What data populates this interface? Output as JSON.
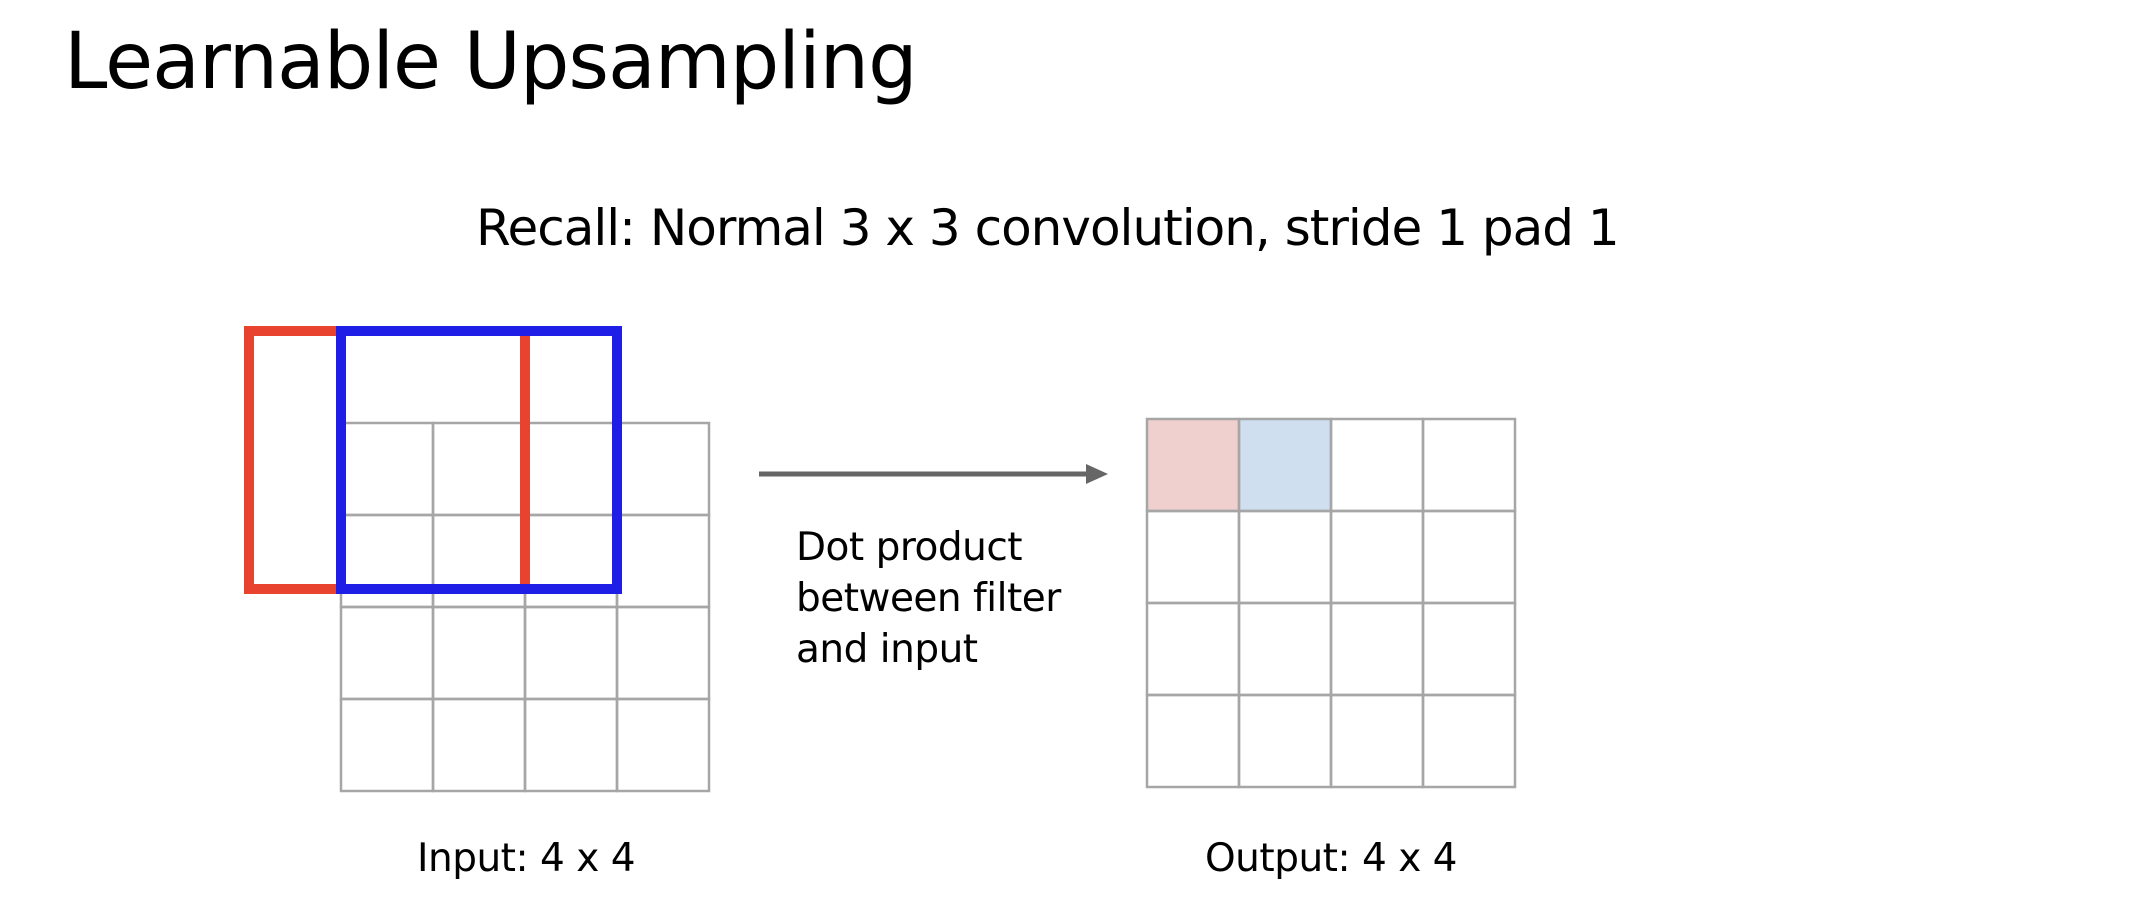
{
  "slide": {
    "title": "Learnable Upsampling",
    "subtitle": "Recall: Normal 3 x 3 convolution, stride 1 pad 1"
  },
  "caption": {
    "lines": [
      "Dot product",
      "between filter",
      "and input"
    ]
  },
  "input_grid": {
    "label": "Input: 4 x 4",
    "rows": 4,
    "cols": 4
  },
  "output_grid": {
    "label": "Output: 4 x 4",
    "rows": 4,
    "cols": 4,
    "highlighted_cells": [
      {
        "row": 0,
        "col": 0,
        "color": "#f0cfcf"
      },
      {
        "row": 0,
        "col": 1,
        "color": "#cfdff0"
      }
    ]
  },
  "filters": [
    {
      "name": "first-filter-window",
      "color": "#e8432e",
      "top_left": [
        -1,
        -1
      ],
      "size": 3
    },
    {
      "name": "second-filter-window",
      "color": "#1e1ee6",
      "top_left": [
        -1,
        0
      ],
      "size": 3
    }
  ],
  "colors": {
    "grid_line": "#a6a6a6",
    "arrow": "#666666",
    "text": "#000000"
  }
}
